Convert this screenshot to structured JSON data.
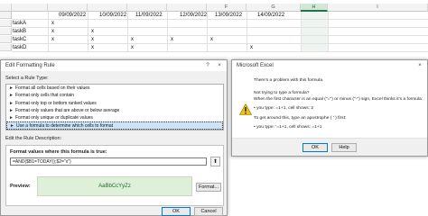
{
  "sheet": {
    "columns": [
      "F",
      "G",
      "H",
      "I"
    ],
    "dates": [
      "09/09/2022",
      "10/09/2022",
      "11/09/2022",
      "12/09/2022",
      "13/09/2022",
      "14/09/2022"
    ],
    "tasks": [
      "taskA",
      "taskB",
      "taskC",
      "taskD"
    ],
    "mark": "x"
  },
  "format_dialog": {
    "title": "Edit Formatting Rule",
    "help_glyph": "?",
    "close_glyph": "×",
    "select_rule_type_label": "Select a Rule Type:",
    "rule_types": [
      "Format all cells based on their values",
      "Format only cells that contain",
      "Format only top or bottom ranked values",
      "Format only values that are above or below average",
      "Format only unique or duplicate values",
      "Use a formula to determine which cells to format"
    ],
    "selected_rule_index": 5,
    "edit_description_label": "Edit the Rule Description:",
    "formula_label": "Format values where this formula is true:",
    "formula_value": "=AND($B1=TODAY();$2=\"x\")",
    "preview_label": "Preview:",
    "preview_sample": "AaBbCcYyZz",
    "format_button": "Format...",
    "ok_button": "OK",
    "cancel_button": "Cancel"
  },
  "message_box": {
    "title": "Microsoft Excel",
    "close_glyph": "×",
    "line1": "There's a problem with this formula.",
    "line2": "Not trying to type a formula?",
    "line3": "When the first character is an equal (\"=\") or minus (\"-\") sign, Excel thinks it's a formula:",
    "line4": "• you type:   =1+1, cell shows:   2",
    "line5": "To get around this, type an apostrophe ( ' ) first:",
    "line6": "• you type:   '=1+1, cell shows:   =1+1",
    "ok_button": "OK",
    "help_button": "Help"
  },
  "colors": {
    "accent": "#0078d7",
    "excel_green": "#217346",
    "preview_fill": "#dff0d8",
    "warning": "#f5c400"
  }
}
